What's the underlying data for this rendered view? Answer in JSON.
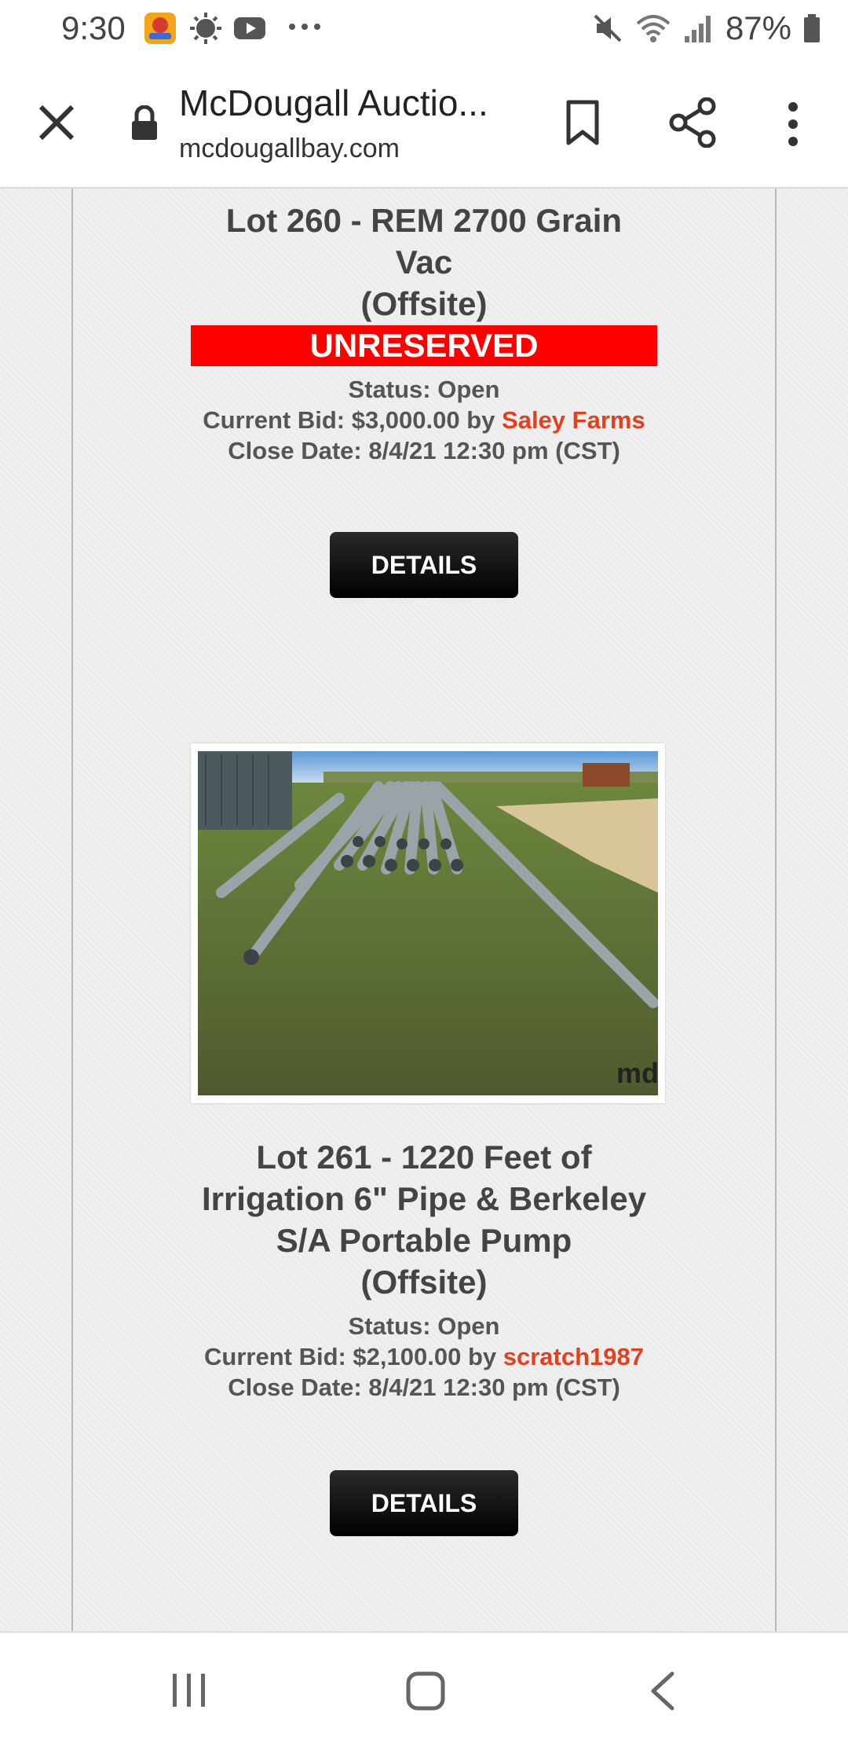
{
  "status_bar": {
    "time": "9:30",
    "battery": "87%",
    "icons": [
      "game-app-icon",
      "weather-icon",
      "youtube-icon",
      "more-notifications-icon",
      "mute-icon",
      "wifi-icon",
      "signal-icon",
      "battery-icon"
    ]
  },
  "browser": {
    "title": "McDougall Auctio...",
    "url": "mcdougallbay.com",
    "icons": [
      "close-icon",
      "lock-icon",
      "bookmark-icon",
      "share-icon",
      "more-vert-icon"
    ]
  },
  "lots": [
    {
      "title_lines": [
        "Lot 260 - REM 2700 Grain",
        "Vac",
        "(Offsite)"
      ],
      "badge": "UNRESERVED",
      "status": "Status: Open",
      "bid_prefix": "Current Bid: $3,000.00 by ",
      "bidder": "Saley Farms",
      "close_date": "Close Date: 8/4/21 12:30 pm (CST)",
      "button": "DETAILS"
    },
    {
      "photo_alt": "irrigation pipes on grass",
      "watermark": "md",
      "title_lines": [
        "Lot 261 - 1220 Feet of",
        "Irrigation 6\" Pipe & Berkeley",
        "S/A Portable Pump",
        "(Offsite)"
      ],
      "status": "Status: Open",
      "bid_prefix": "Current Bid: $2,100.00 by ",
      "bidder": "scratch1987",
      "close_date": "Close Date: 8/4/21 12:30 pm (CST)",
      "button": "DETAILS"
    }
  ],
  "nav_bar": {
    "icons": [
      "recents-icon",
      "home-icon",
      "back-icon"
    ]
  },
  "colors": {
    "unreserved_bg": "#ff0000",
    "bidder_link": "#e2401e",
    "button_bg": "#000000"
  }
}
